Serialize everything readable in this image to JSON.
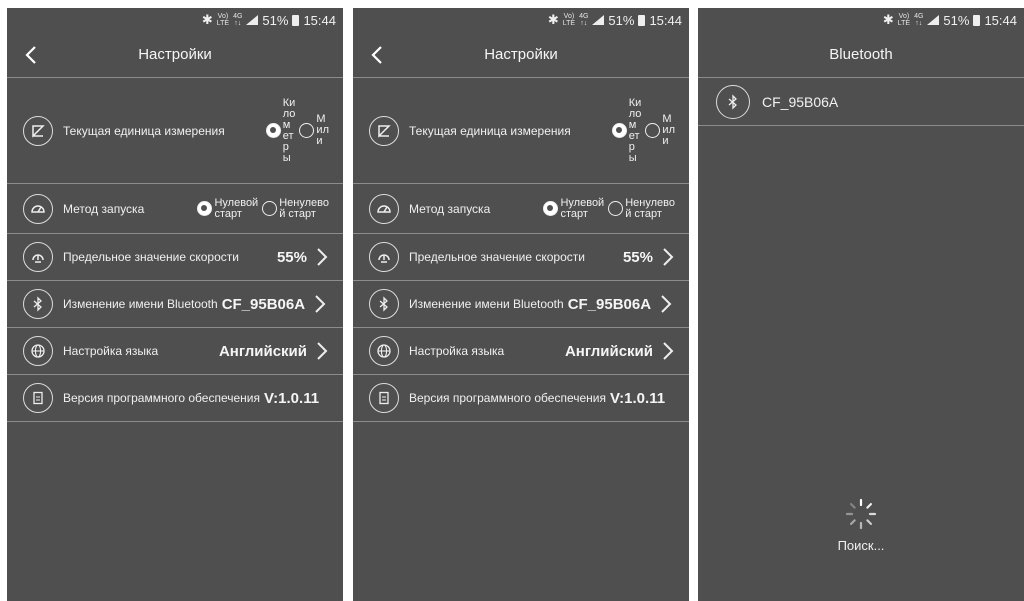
{
  "status": {
    "bt": "✱",
    "volte_top": "Vo)",
    "volte_bottom": "LTE",
    "net_top": "4G",
    "net_bottom": "↑↓",
    "battery": "51%",
    "time": "15:44"
  },
  "settings": {
    "title": "Настройки",
    "unit_label": "Текущая единица измерения",
    "unit_km": "Ки\nло\nм\nет\nр\nы",
    "unit_mi": "М\nил\nи",
    "start_label": "Метод запуска",
    "start_zero": "Нулевой\nстарт",
    "start_nonzero": "Ненулево\nй старт",
    "speed_label": "Предельное значение скорости",
    "speed_value": "55%",
    "bt_label": "Изменение имени Bluetooth",
    "bt_value": "CF_95B06A",
    "lang_label": "Настройка языка",
    "lang_value": "Английский",
    "version_label": "Версия программного обеспечения",
    "version_value": "V:1.0.11"
  },
  "bluetooth": {
    "title": "Bluetooth",
    "device": "CF_95B06A",
    "searching": "Поиск..."
  }
}
